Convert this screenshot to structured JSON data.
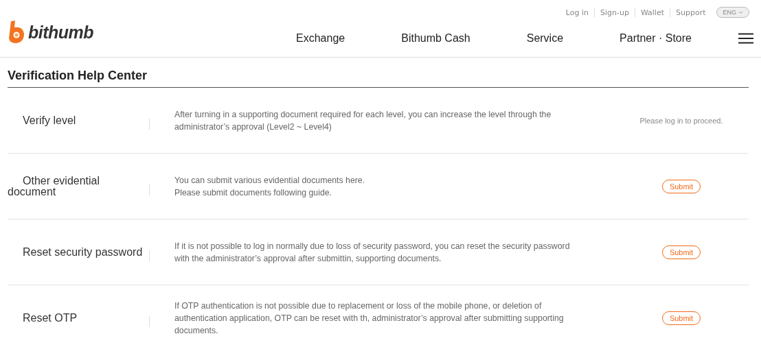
{
  "header": {
    "logo": "bithumb",
    "top_links": [
      "Log in",
      "Sign-up",
      "Wallet",
      "Support"
    ],
    "language": "ENG",
    "nav": [
      "Exchange",
      "Bithumb Cash",
      "Service",
      "Partner · Store"
    ]
  },
  "page_title": "Verification Help Center",
  "rows": [
    {
      "title": "Verify level",
      "description": "After turning in a supporting document required for each level, you can increase the level through the administrator’s approval (Level2 ~ Level4)",
      "action": {
        "kind": "note",
        "text": "Please log in to proceed."
      }
    },
    {
      "title": "Other evidential document",
      "description": "You can submit various evidential documents here.\nPlease submit documents following guide.",
      "action": {
        "kind": "button",
        "text": "Submit"
      }
    },
    {
      "title": "Reset security password",
      "description": "If it is not possible to log in normally due to loss of security password, you can reset the security password with the administrator’s approval after submittin, supporting documents.",
      "action": {
        "kind": "button",
        "text": "Submit"
      }
    },
    {
      "title": "Reset OTP",
      "description": "If OTP authentication is not possible due to replacement or loss of the mobile phone, or deletion of authentication application, OTP can be reset with th, administrator’s approval after submitting supporting documents.",
      "action": {
        "kind": "button",
        "text": "Submit"
      }
    }
  ]
}
